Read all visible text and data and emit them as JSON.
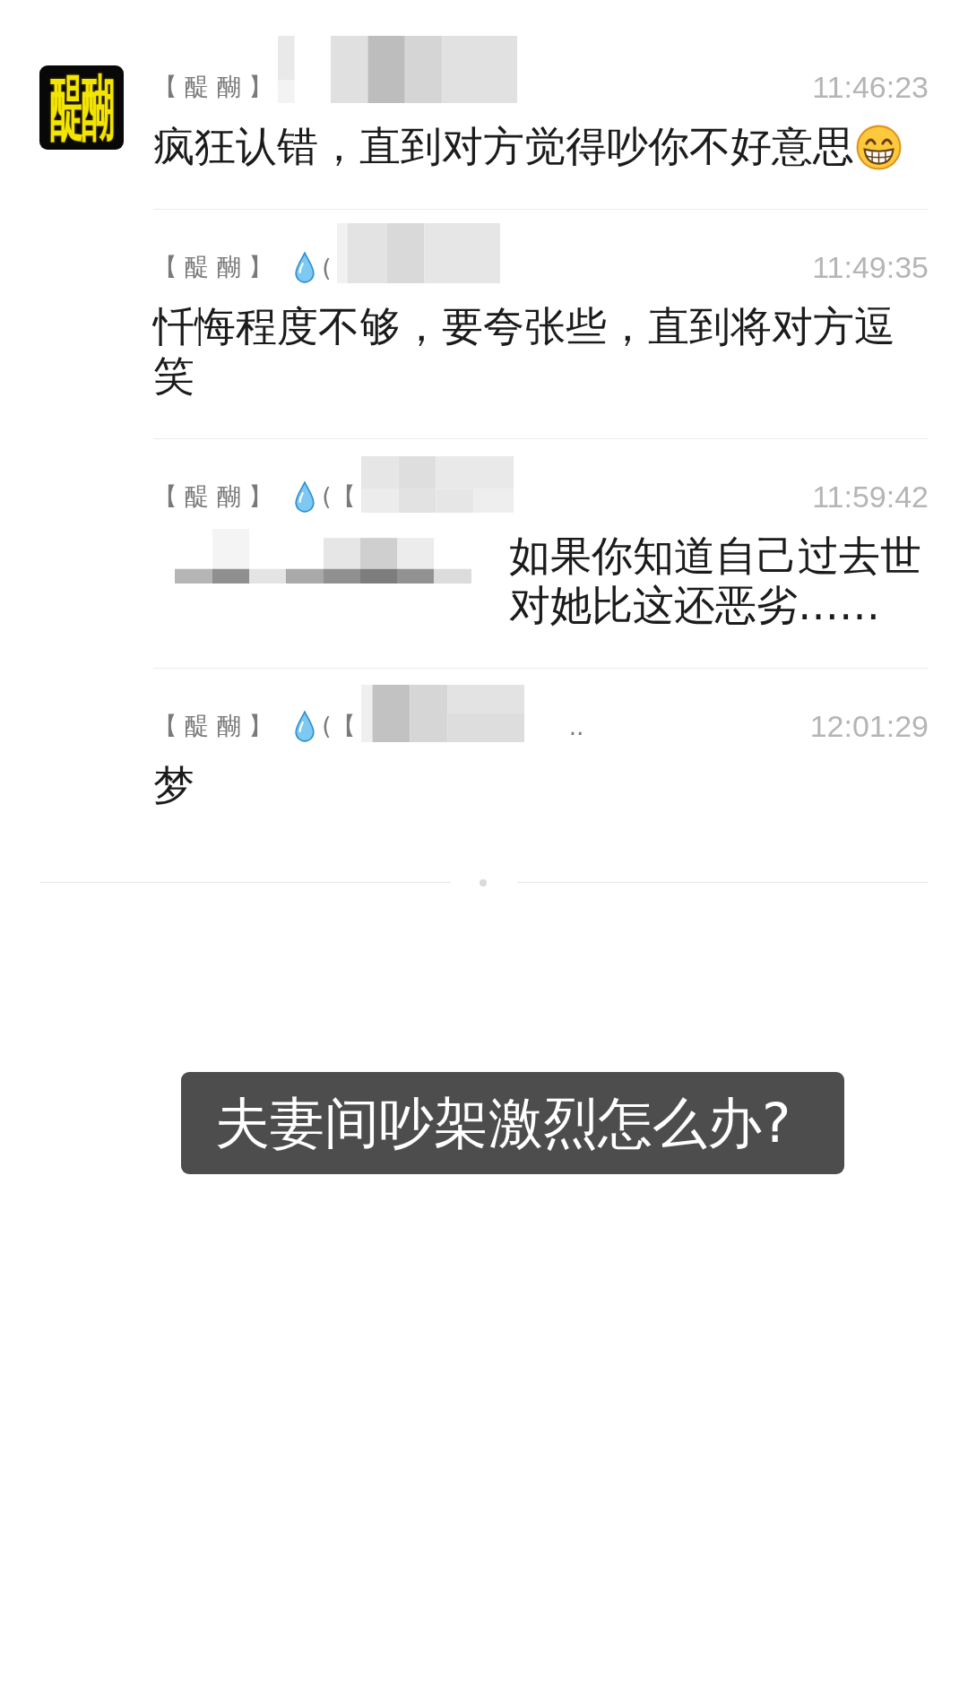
{
  "avatar": {
    "text": "醍醐"
  },
  "messages": [
    {
      "header": [
        {
          "kind": "name",
          "text": "【 醍 醐 】"
        },
        {
          "kind": "redaction"
        }
      ],
      "time": "11:46:23",
      "body": [
        {
          "kind": "text",
          "text": "疯狂认错，直到对方觉得吵你不好意思"
        },
        {
          "kind": "emoji"
        }
      ]
    },
    {
      "header": [
        {
          "kind": "name",
          "text": "【 醍 醐 】"
        },
        {
          "kind": "drop"
        },
        {
          "kind": "text",
          "text": "("
        },
        {
          "kind": "redaction"
        }
      ],
      "time": "11:49:35",
      "body": [
        {
          "kind": "text",
          "text": "忏悔程度不够，要夸张些，直到将对方逗笑"
        }
      ]
    },
    {
      "header": [
        {
          "kind": "name",
          "text": "【 醍 醐 】"
        },
        {
          "kind": "drop"
        },
        {
          "kind": "text",
          "text": "(【"
        },
        {
          "kind": "redaction"
        }
      ],
      "time": "11:59:42",
      "body": [
        {
          "kind": "redaction"
        },
        {
          "kind": "text",
          "text": "如果你知道自己过去世对她比这还恶劣……"
        }
      ]
    },
    {
      "header": [
        {
          "kind": "name",
          "text": "【 醍 醐 】"
        },
        {
          "kind": "drop"
        },
        {
          "kind": "text",
          "text": "(【"
        },
        {
          "kind": "redaction"
        },
        {
          "kind": "text",
          "text": ".."
        }
      ],
      "time": "12:01:29",
      "body": [
        {
          "kind": "text",
          "text": "梦"
        }
      ]
    }
  ],
  "caption": "夫妻间吵架激烈怎么办?"
}
